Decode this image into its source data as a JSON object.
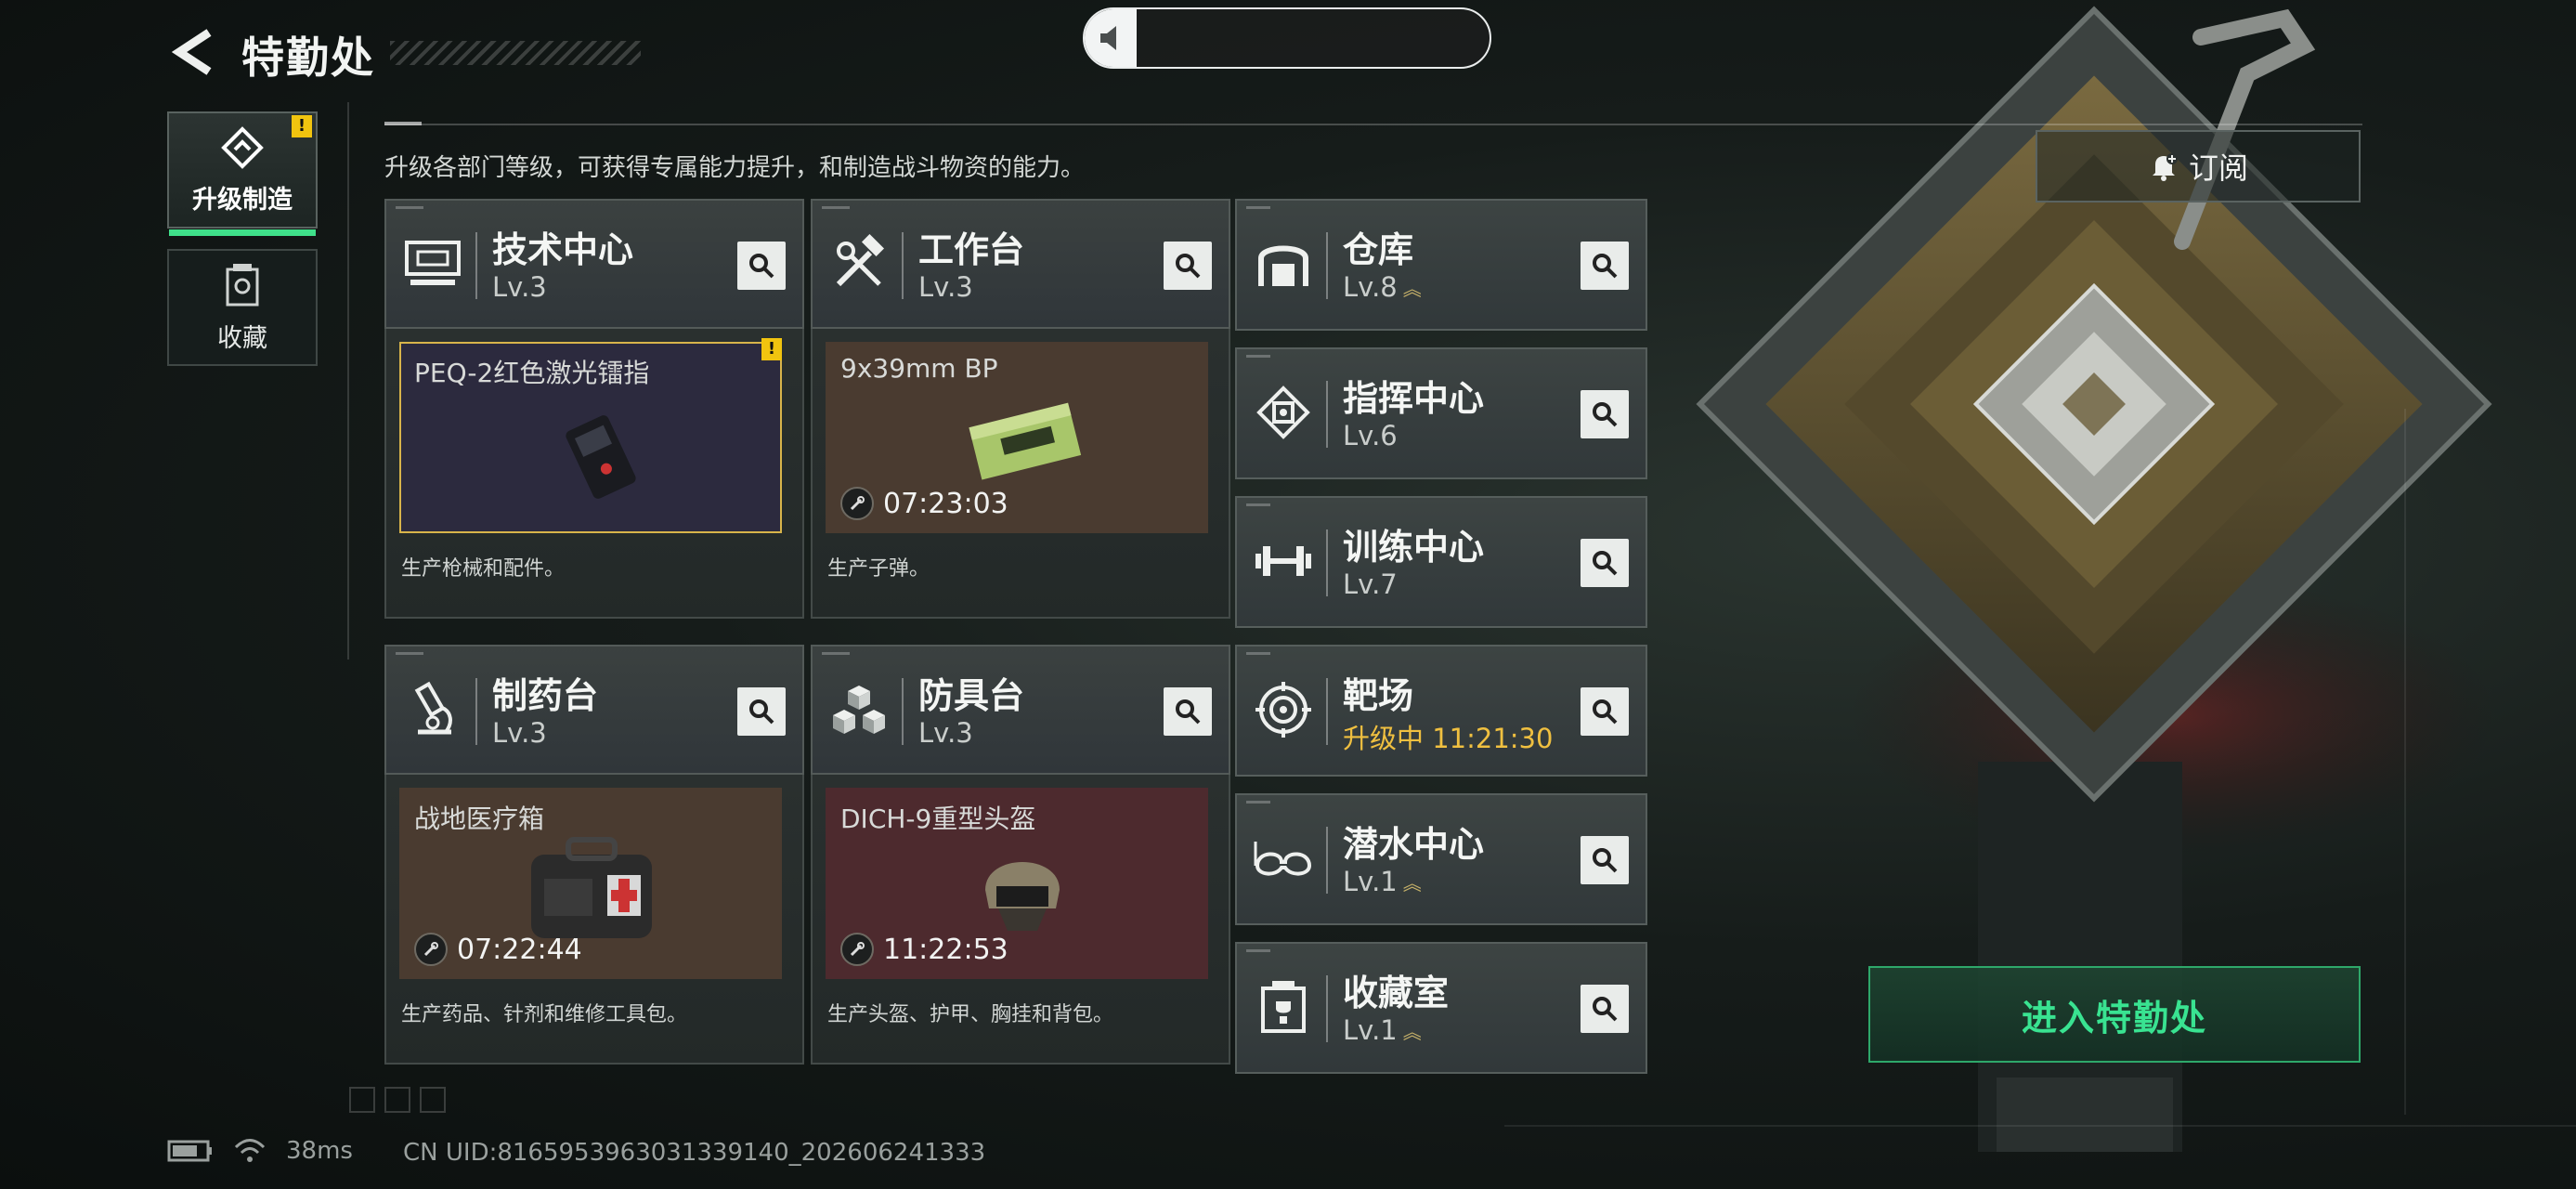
{
  "header": {
    "title": "特勤处",
    "back_icon": "back-arrow-icon",
    "volume_level": 0.04
  },
  "nav": {
    "tabs": [
      {
        "label": "升级制造",
        "icon": "upgrade-craft-icon",
        "active": true,
        "warning": "!"
      },
      {
        "label": "收藏",
        "icon": "collection-icon",
        "active": false
      }
    ]
  },
  "subtitle": "升级各部门等级，可获得专属能力提升，和制造战斗物资的能力。",
  "departments": {
    "tech_center": {
      "name": "技术中心",
      "level": "Lv.3",
      "icon": "computer-icon",
      "item": "PEQ-2红色激光镭指",
      "item_warning": "!",
      "desc": "生产枪械和配件。"
    },
    "workbench": {
      "name": "工作台",
      "level": "Lv.3",
      "icon": "tools-icon",
      "item": "9x39mm BP",
      "timer": "07:23:03",
      "desc": "生产子弹。"
    },
    "pharmacy": {
      "name": "制药台",
      "level": "Lv.3",
      "icon": "microscope-icon",
      "item": "战地医疗箱",
      "timer": "07:22:44",
      "desc": "生产药品、针剂和维修工具包。"
    },
    "armor_bench": {
      "name": "防具台",
      "level": "Lv.3",
      "icon": "blocks-icon",
      "item": "DICH-9重型头盔",
      "timer": "11:22:53",
      "desc": "生产头盔、护甲、胸挂和背包。"
    },
    "list": [
      {
        "name": "仓库",
        "level": "Lv.8",
        "icon": "warehouse-icon",
        "upgradable": true
      },
      {
        "name": "指挥中心",
        "level": "Lv.6",
        "icon": "command-chip-icon",
        "upgradable": false
      },
      {
        "name": "训练中心",
        "level": "Lv.7",
        "icon": "dumbbell-icon",
        "upgradable": false
      },
      {
        "name": "靶场",
        "level": "升级中 11:21:30",
        "icon": "target-icon",
        "upgradable": false
      },
      {
        "name": "潜水中心",
        "level": "Lv.1",
        "icon": "goggles-icon",
        "upgradable": true
      },
      {
        "name": "收藏室",
        "level": "Lv.1",
        "icon": "trophy-case-icon",
        "upgradable": true
      }
    ]
  },
  "actions": {
    "subscribe": "订阅",
    "enter": "进入特勤处"
  },
  "status": {
    "latency": "38ms",
    "uid": "CN UID:8165953963031339140_202606241333"
  },
  "colors": {
    "accent_green": "#3fe08a",
    "warning_yellow": "#f1c40f",
    "upgrading_gold": "#f0c040"
  }
}
